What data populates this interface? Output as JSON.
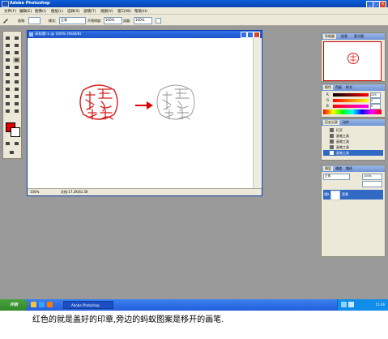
{
  "window": {
    "title": "Adobe Photoshop",
    "min_label": "_",
    "max_label": "□",
    "close_label": "×"
  },
  "menu": [
    "文件(F)",
    "编辑(E)",
    "图像(I)",
    "图层(L)",
    "选择(S)",
    "滤镜(T)",
    "视图(V)",
    "窗口(W)",
    "帮助(H)"
  ],
  "options_bar": {
    "brush_label": "画笔:",
    "mode_label": "模式:",
    "mode_value": "正常",
    "opacity_label": "不透明度:",
    "opacity_value": "100%",
    "flow_label": "流量:",
    "flow_value": "100%"
  },
  "document": {
    "title": "未标题-1 @ 100% (RGB/8)",
    "zoom": "100%",
    "info": "文档:17.2K/61.5K"
  },
  "navigator": {
    "tabs": [
      "导航器",
      "信息",
      "直方图"
    ]
  },
  "color_panel": {
    "tabs": [
      "颜色",
      "色板",
      "样式"
    ],
    "channels": [
      {
        "letter": "R",
        "value": "255"
      },
      {
        "letter": "G",
        "value": "0"
      },
      {
        "letter": "B",
        "value": "0"
      }
    ]
  },
  "history": {
    "tabs": [
      "历史记录",
      "动作"
    ],
    "items": [
      "打开",
      "画笔工具",
      "画笔工具",
      "画笔工具",
      "画笔工具"
    ],
    "selected_index": 4
  },
  "layers": {
    "tabs": [
      "图层",
      "通道",
      "路径"
    ],
    "blend_mode": "正常",
    "opacity": "100%",
    "layer_name": "背景"
  },
  "taskbar": {
    "start_label": "开始",
    "task_label": "Adobe Photoshop",
    "clock": "15:36"
  },
  "caption": "红色的就是盖好的印章,旁边的蚂蚁图案是移开的画笔.",
  "colors": {
    "seal_red": "#d81e1e",
    "arrow_red": "#e00000",
    "selection_blue": "#316ac5",
    "workspace_gray": "#9a9a9a"
  }
}
